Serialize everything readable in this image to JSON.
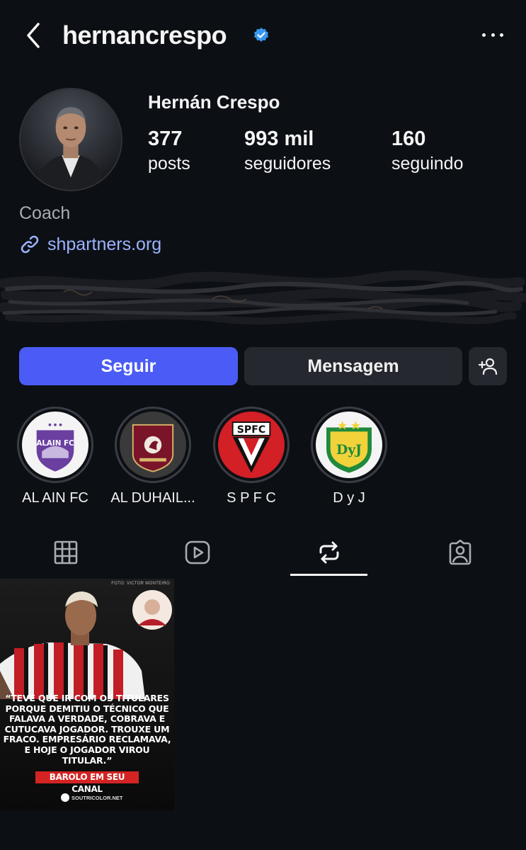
{
  "header": {
    "username": "hernancrespo",
    "verified": true,
    "back_icon": "chevron-left-icon",
    "more_icon": "more-horizontal-icon"
  },
  "profile": {
    "full_name": "Hernán Crespo",
    "stats": [
      {
        "value": "377",
        "label": "posts"
      },
      {
        "value": "993 mil",
        "label": "seguidores"
      },
      {
        "value": "160",
        "label": "seguindo"
      }
    ],
    "category": "Coach",
    "link": "shpartners.org"
  },
  "actions": {
    "follow_label": "Seguir",
    "message_label": "Mensagem",
    "add_user_icon": "add-user-icon"
  },
  "highlights": [
    {
      "label": "AL AIN FC"
    },
    {
      "label": "AL DUHAIL..."
    },
    {
      "label": "S P F C"
    },
    {
      "label": "D y J"
    }
  ],
  "highlight_art": {
    "spfc": "SPFC",
    "dyj": "DyJ"
  },
  "tabs": [
    {
      "name": "grid",
      "icon": "grid-icon"
    },
    {
      "name": "reels",
      "icon": "reels-icon"
    },
    {
      "name": "reposts",
      "icon": "repost-icon",
      "active": true
    },
    {
      "name": "tagged",
      "icon": "tagged-icon"
    }
  ],
  "post": {
    "credit": "FOTO: VICTOR MONTEIRO",
    "quote": "“Teve que ir com os titulares porque demitiu o técnico que falava a verdade, cobrava e cutucava jogador. Trouxe um fraco. Empresário reclamava, e hoje o jogador virou titular.”",
    "badge": "BAROLO EM SEU CANAL",
    "brand": "SOUTRICOLOR.NET"
  },
  "colors": {
    "background": "#0c0f14",
    "follow_button": "#4a5cf5",
    "secondary_button": "#25282e",
    "link": "#9bb4ff",
    "verified": "#3897f0"
  }
}
